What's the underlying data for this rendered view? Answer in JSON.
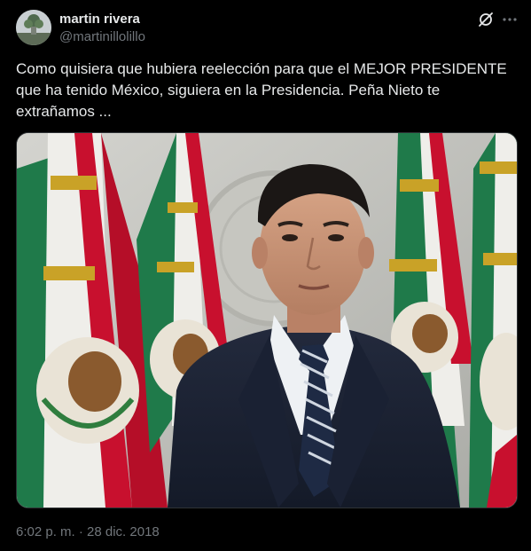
{
  "author": {
    "name": "martin rivera",
    "handle": "@martinillolillo"
  },
  "post": {
    "text": "Como quisiera que hubiera reelección para que el MEJOR PRESIDENTE\nque ha tenido México, siguiera en la Presidencia. Peña Nieto te\nextrañamos ...",
    "timestamp": "6:02 p. m. · 28 dic. 2018"
  },
  "icons": {
    "grok": "grok-icon",
    "more": "more-icon"
  },
  "colors": {
    "background": "#000000",
    "text_primary": "#e7e9ea",
    "text_secondary": "#71767b",
    "border": "#2f3336",
    "flag_green": "#1f7a4a",
    "flag_red": "#c8102e",
    "suit": "#1c2233"
  }
}
